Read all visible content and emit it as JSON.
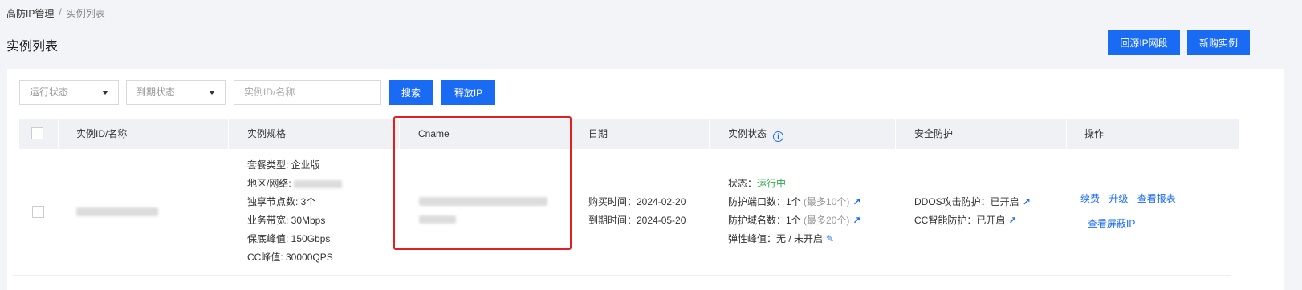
{
  "breadcrumb": {
    "root": "高防IP管理",
    "sep": "/",
    "current": "实例列表"
  },
  "page_title": "实例列表",
  "top_buttons": {
    "source_ip": "回源IP网段",
    "new_instance": "新购实例"
  },
  "filters": {
    "run_status": "运行状态",
    "expire_status": "到期状态",
    "search_placeholder": "实例ID/名称",
    "search_btn": "搜索",
    "release_btn": "释放IP"
  },
  "table": {
    "headers": {
      "id": "实例ID/名称",
      "spec": "实例规格",
      "cname": "Cname",
      "date": "日期",
      "status": "实例状态",
      "security": "安全防护",
      "ops": "操作"
    },
    "row": {
      "spec": {
        "type": "套餐类型: 企业版",
        "region": "地区/网络: ",
        "nodes": "独享节点数: 3个",
        "bandwidth": "业务带宽: 30Mbps",
        "guarantee": "保底峰值: 150Gbps",
        "cc": "CC峰值: 30000QPS"
      },
      "date": {
        "buy": "购买时间：2024-02-20",
        "expire": "到期时间：2024-05-20"
      },
      "status": {
        "state_label": "状态：",
        "state_value": "运行中",
        "ports_label": "防护端口数：",
        "ports_value": "1个",
        "ports_max": "(最多10个)",
        "domains_label": "防护域名数：",
        "domains_value": "1个",
        "domains_max": "(最多20个)",
        "elastic_label": "弹性峰值：",
        "elastic_value": "无 / 未开启"
      },
      "security": {
        "ddos_label": "DDOS攻击防护：",
        "ddos_value": "已开启",
        "cc_label": "CC智能防护：",
        "cc_value": "已开启"
      },
      "ops": {
        "renew": "续费",
        "upgrade": "升级",
        "report": "查看报表",
        "blocked_ip": "查看屏蔽IP"
      }
    }
  },
  "colors": {
    "primary": "#1a6bf3",
    "running": "#2bab4b",
    "highlight_border": "#e02020"
  }
}
